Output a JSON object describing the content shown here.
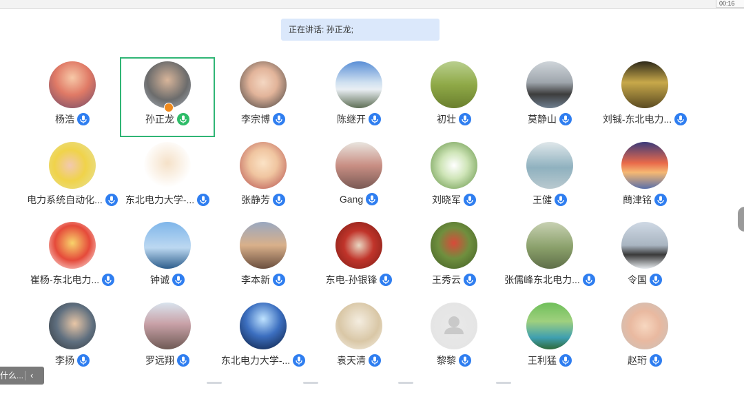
{
  "topbar": {
    "timer": "00:16"
  },
  "speaking": {
    "text": "正在讲话: 孙正龙;"
  },
  "participants": [
    {
      "name": "杨浩",
      "mic": "blue"
    },
    {
      "name": "孙正龙",
      "mic": "green",
      "speaking": true,
      "host": true
    },
    {
      "name": "李宗博",
      "mic": "blue"
    },
    {
      "name": "陈继开",
      "mic": "blue"
    },
    {
      "name": "初壮",
      "mic": "blue"
    },
    {
      "name": "莫静山",
      "mic": "blue"
    },
    {
      "name": "刘铖-东北电力...",
      "mic": "blue"
    },
    {
      "name": "电力系统自动化...",
      "mic": "blue"
    },
    {
      "name": "东北电力大学-...",
      "mic": "blue"
    },
    {
      "name": "张静芳",
      "mic": "blue"
    },
    {
      "name": "Gang",
      "mic": "blue"
    },
    {
      "name": "刘晓军",
      "mic": "blue"
    },
    {
      "name": "王健",
      "mic": "blue"
    },
    {
      "name": "蔄津铭",
      "mic": "blue"
    },
    {
      "name": "崔杨-东北电力...",
      "mic": "blue"
    },
    {
      "name": "钟诚",
      "mic": "blue"
    },
    {
      "name": "李本新",
      "mic": "blue"
    },
    {
      "name": "东电-孙银锋",
      "mic": "blue"
    },
    {
      "name": "王秀云",
      "mic": "blue"
    },
    {
      "name": "张儒峰东北电力...",
      "mic": "blue"
    },
    {
      "name": "令国",
      "mic": "blue"
    },
    {
      "name": "李扬",
      "mic": "blue"
    },
    {
      "name": "罗远翔",
      "mic": "blue"
    },
    {
      "name": "东北电力大学-...",
      "mic": "blue"
    },
    {
      "name": "袁天清",
      "mic": "blue"
    },
    {
      "name": "黎黎",
      "mic": "blue"
    },
    {
      "name": "王利猛",
      "mic": "blue"
    },
    {
      "name": "赵珩",
      "mic": "blue"
    }
  ],
  "side_panel": {
    "collapsed_text": "什么..."
  },
  "colors": {
    "speaking_border": "#2fb575",
    "mic_blue": "#2f7ef0",
    "mic_green": "#2ebc68",
    "speaking_bar_bg": "#dbe8fb"
  }
}
